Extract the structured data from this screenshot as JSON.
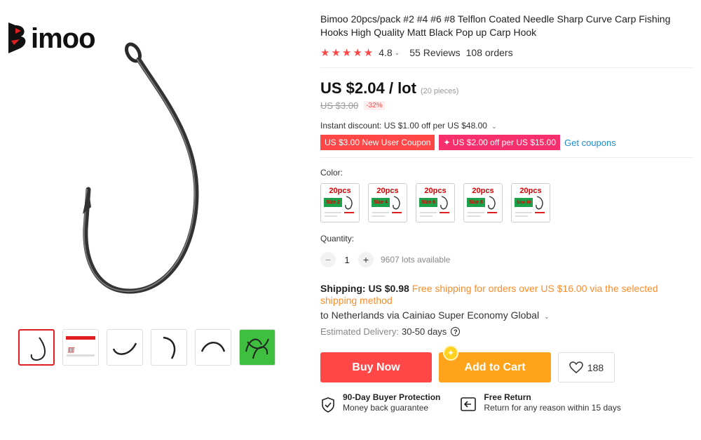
{
  "brand": {
    "logo_text": "imoo",
    "logo_full": "Bimoo"
  },
  "gallery": {
    "thumbnails": [
      "thumb-1",
      "thumb-2",
      "thumb-3",
      "thumb-4",
      "thumb-5",
      "thumb-6"
    ]
  },
  "product": {
    "title": "Bimoo 20pcs/pack #2 #4 #6 #8 Telflon Coated Needle Sharp Curve Carp Fishing Hooks High Quality Matt Black Pop up Carp Hook",
    "rating": "4.8",
    "stars": "★★★★★",
    "reviews": "55 Reviews",
    "orders": "108 orders"
  },
  "price": {
    "current": "US $2.04 / lot",
    "pieces": "(20 pieces)",
    "original": "US $3.00",
    "discount": "-32%"
  },
  "promotions": {
    "instant": "Instant discount: US $1.00 off per US $48.00",
    "coupon1": "US $3.00 New User Coupon",
    "coupon2": "✦ US $2.00 off per US $15.00",
    "get_coupons": "Get coupons"
  },
  "color": {
    "label": "Color:",
    "options": [
      {
        "pcs": "20pcs",
        "size": "Size 2"
      },
      {
        "pcs": "20pcs",
        "size": "Size 4"
      },
      {
        "pcs": "20pcs",
        "size": "Size 6"
      },
      {
        "pcs": "20pcs",
        "size": "Size 8"
      },
      {
        "pcs": "20pcs",
        "size": "Size 10"
      }
    ]
  },
  "quantity": {
    "label": "Quantity:",
    "minus": "−",
    "value": "1",
    "plus": "+",
    "available": "9607 lots available"
  },
  "shipping": {
    "label": "Shipping:",
    "cost": "US $0.98",
    "free_text": "Free shipping for orders over US $16.00 via the selected shipping method",
    "to": "to Netherlands via Cainiao Super Economy Global",
    "est_label": "Estimated Delivery:",
    "est_value": "30-50 days"
  },
  "actions": {
    "buy_now": "Buy Now",
    "add_to_cart": "Add to Cart",
    "wishlist_count": "188"
  },
  "guarantees": {
    "protection_title": "90-Day Buyer Protection",
    "protection_sub": "Money back guarantee",
    "return_title": "Free Return",
    "return_sub": "Return for any reason within 15 days"
  },
  "colors": {
    "accent_red": "#ff4747",
    "accent_orange": "#ffa31a",
    "coupon_pink": "#f5306d",
    "link_blue": "#1a8dd2",
    "free_orange": "#fd8c2a"
  }
}
